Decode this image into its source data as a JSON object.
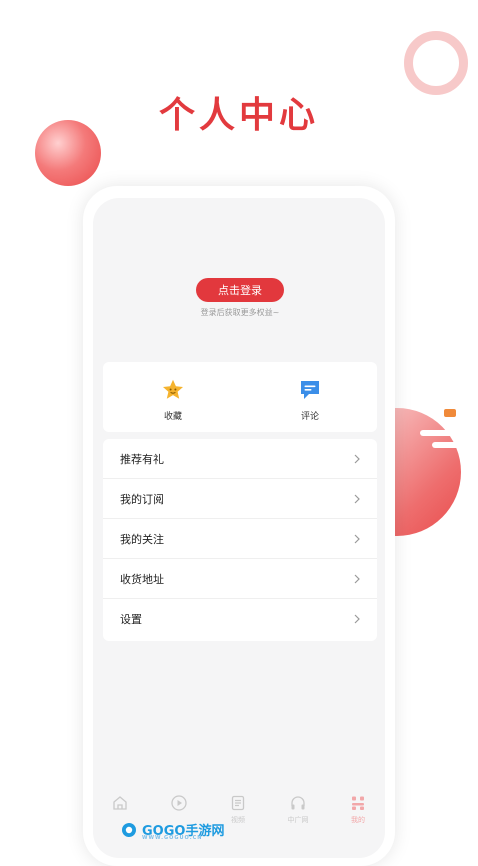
{
  "banner": {
    "title": "个人中心"
  },
  "profile": {
    "login_button": "点击登录",
    "login_hint": "登录后获取更多权益~"
  },
  "quick_actions": [
    {
      "label": "收藏",
      "icon": "star-icon",
      "color": "#f5b32e"
    },
    {
      "label": "评论",
      "icon": "comment-icon",
      "color": "#3b8ee8"
    }
  ],
  "menu": [
    {
      "label": "推荐有礼"
    },
    {
      "label": "我的订阅"
    },
    {
      "label": "我的关注"
    },
    {
      "label": "收货地址"
    },
    {
      "label": "设置"
    }
  ],
  "tabs": [
    {
      "label": "",
      "icon": "home-icon"
    },
    {
      "label": "",
      "icon": "play-icon"
    },
    {
      "label": "视频",
      "icon": "news-icon"
    },
    {
      "label": "中广网",
      "icon": "headphones-icon"
    },
    {
      "label": "我的",
      "icon": "profile-icon",
      "active": true
    }
  ],
  "watermark": {
    "brand": "GOGO手游网",
    "url": "WWW.GOGUO.CN"
  },
  "colors": {
    "accent": "#e2383d",
    "star": "#f5b32e",
    "comment": "#3b8ee8"
  }
}
